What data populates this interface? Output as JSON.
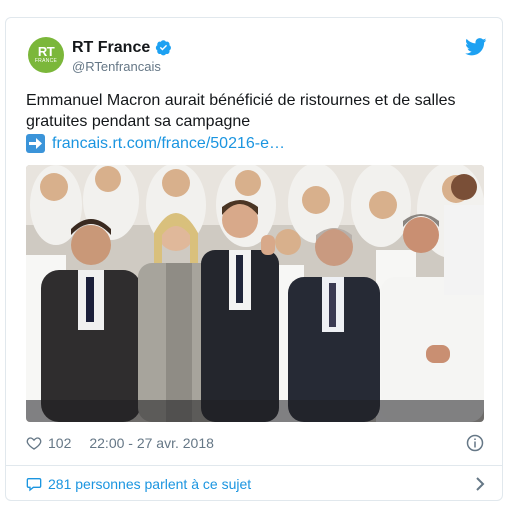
{
  "account": {
    "display_name": "RT France",
    "handle": "@RTenfrancais",
    "avatar_text": "RT",
    "avatar_subtext": "FRANCE",
    "verified": true,
    "avatar_color": "#7bb73a"
  },
  "tweet": {
    "text": "Emmanuel Macron aurait bénéficié de ristournes et de salles gratuites pendant sa campagne",
    "link_text": "francais.rt.com/france/50216-e…",
    "link_emoji": "right-arrow-icon"
  },
  "meta": {
    "likes": "102",
    "timestamp": "22:00 - 27 avr. 2018"
  },
  "footer": {
    "conversation": "281 personnes parlent à ce sujet"
  },
  "colors": {
    "link": "#1b95e0",
    "secondary_text": "#657786",
    "border": "#e1e8ed",
    "twitter_blue": "#1da1f2"
  }
}
